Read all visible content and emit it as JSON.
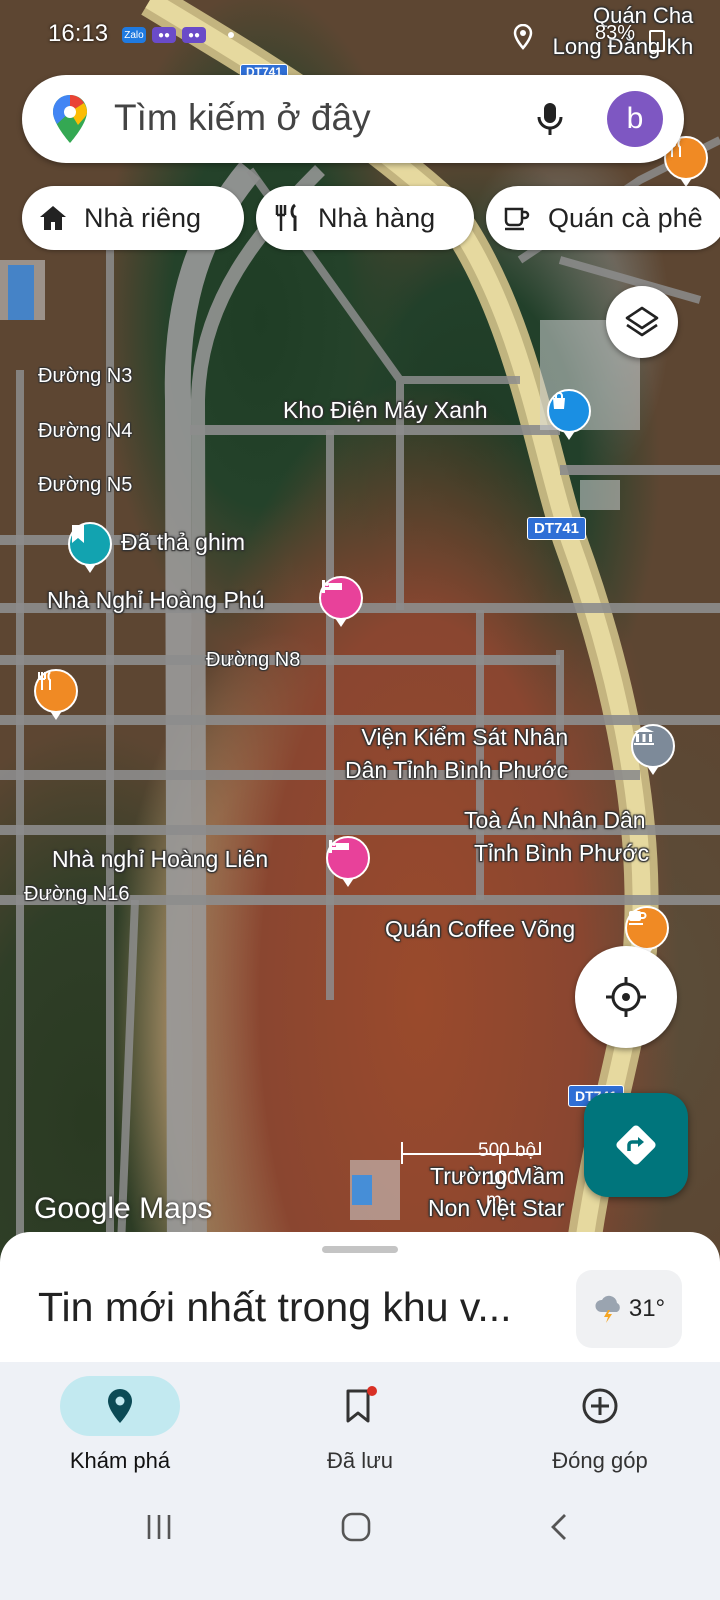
{
  "status_bar": {
    "time": "16:13",
    "apps": [
      "Zalo",
      "",
      ""
    ],
    "battery": "83%"
  },
  "search": {
    "placeholder": "Tìm kiếm ở đây",
    "avatar_letter": "b"
  },
  "chips": [
    {
      "label": "Nhà riêng",
      "icon": "home-icon"
    },
    {
      "label": "Nhà hàng",
      "icon": "restaurant-icon"
    },
    {
      "label": "Quán cà phê",
      "icon": "coffee-icon"
    }
  ],
  "map": {
    "roads": [
      "Đường N3",
      "Đường N4",
      "Đường N5",
      "Đường N8",
      "Đường N16"
    ],
    "route_badges": [
      "DT741",
      "DT741",
      "DT741"
    ],
    "places": [
      {
        "name": "Kho Điện Máy Xanh",
        "icon": "shopping-bag-icon",
        "color": "#1a8fe3"
      },
      {
        "name": "Đã thả ghim",
        "icon": "bookmark-icon",
        "color": "#12a3b0"
      },
      {
        "name": "Nhà Nghỉ Hoàng Phú",
        "icon": "hotel-icon",
        "color": "#e8419a"
      },
      {
        "name": "Viện Kiểm Sát Nhân Dân Tỉnh Bình Phước",
        "line1": "Viện Kiểm Sát Nhân",
        "line2": "Dân Tỉnh Bình Phước",
        "icon": "government-icon",
        "color": "#7d8a99"
      },
      {
        "name": "Toà Án Nhân Dân Tỉnh Bình Phước",
        "line1": "Toà Án Nhân Dân",
        "line2": "Tỉnh Bình Phước",
        "icon": "government-icon",
        "color": "#7d8a99"
      },
      {
        "name": "Nhà nghỉ Hoàng Liên",
        "icon": "hotel-icon",
        "color": "#e8419a"
      },
      {
        "name": "Quán Coffee Võng",
        "icon": "coffee-icon",
        "color": "#f08a24"
      },
      {
        "name": "Trường Mầm Non Việt Star",
        "line1": "Trường Mầm",
        "line2": "Non Việt Star"
      },
      {
        "name": "Quán Cha Long Đằng Kh",
        "line1": "Quán Cha",
        "line2": "Long Đằng Kh"
      }
    ],
    "scale_imperial": "500 bộ",
    "scale_metric": "100 m",
    "logo": "Google Maps"
  },
  "sheet": {
    "title": "Tin mới nhất trong khu v...",
    "weather_temp": "31°"
  },
  "bottom_nav": [
    {
      "label": "Khám phá",
      "icon": "location-pin-icon",
      "active": true
    },
    {
      "label": "Đã lưu",
      "icon": "saved-bookmark-icon",
      "active": false
    },
    {
      "label": "Đóng góp",
      "icon": "add-circle-icon",
      "active": false
    }
  ],
  "colors": {
    "accent": "#00757c",
    "active_nav_bg": "#c2e9f0",
    "avatar": "#7e57c2"
  }
}
